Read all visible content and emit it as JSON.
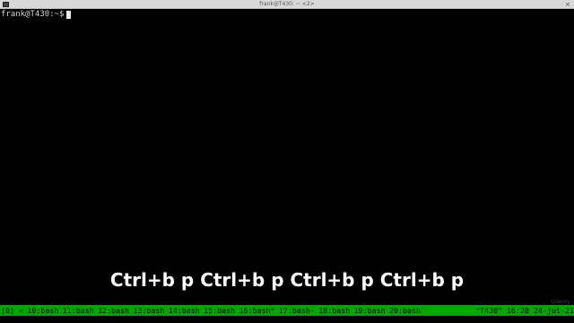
{
  "window": {
    "title": "frank@T430: ~ <2>",
    "close_symbol": "×"
  },
  "terminal": {
    "prompt": "frank@T430:~$"
  },
  "overlay": {
    "keystrokes": "Ctrl+b p Ctrl+b p Ctrl+b p Ctrl+b p"
  },
  "watermark": "Udemy",
  "statusbar": {
    "session": "[0] <",
    "windows": [
      {
        "label": "10:bash"
      },
      {
        "label": "11:bash"
      },
      {
        "label": "12:bash"
      },
      {
        "label": "13:bash"
      },
      {
        "label": "14:bash"
      },
      {
        "label": "15:bash"
      },
      {
        "label": "16:bash*"
      },
      {
        "label": "17:bash-"
      },
      {
        "label": "18:bash"
      },
      {
        "label": "19:bash"
      },
      {
        "label": "20:bash"
      }
    ],
    "right": "\"T430\" 16:28 24-jul-21"
  },
  "colors": {
    "status_bg": "#00a800",
    "terminal_bg": "#000000",
    "text": "#d6d6d6"
  }
}
